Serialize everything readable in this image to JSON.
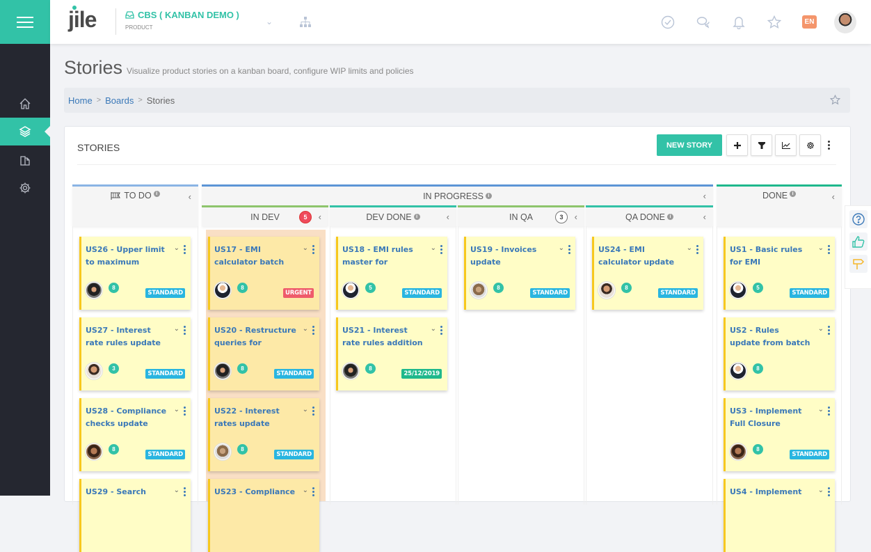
{
  "topbar": {
    "logo": "jile",
    "project_name": "CBS ( KANBAN DEMO )",
    "project_type": "PRODUCT",
    "language": "EN",
    "accent_color": "#32c2a7"
  },
  "sidebar": {
    "items": [
      {
        "name": "home",
        "icon": "home-icon",
        "active": false
      },
      {
        "name": "boards",
        "icon": "layers-icon",
        "active": true
      },
      {
        "name": "documents",
        "icon": "documents-icon",
        "active": false
      },
      {
        "name": "settings",
        "icon": "gear-icon",
        "active": false
      }
    ]
  },
  "page": {
    "title": "Stories",
    "subtitle": "Visualize product stories on a kanban board, configure WIP limits and policies"
  },
  "breadcrumb": {
    "items": [
      "Home",
      "Boards",
      "Stories"
    ]
  },
  "panel": {
    "title": "STORIES",
    "new_story_label": "NEW STORY"
  },
  "board": {
    "groups": {
      "todo": "TO DO",
      "in_progress": "IN PROGRESS",
      "done": "DONE"
    },
    "subcolumns": {
      "in_dev": {
        "label": "IN DEV",
        "wip": "5"
      },
      "dev_done": {
        "label": "DEV DONE"
      },
      "in_qa": {
        "label": "IN QA",
        "wip": "3"
      },
      "qa_done": {
        "label": "QA DONE"
      }
    },
    "columns": {
      "todo": [
        {
          "title": "US26 - Upper limit to maximum",
          "points": "8",
          "tag": "STANDARD",
          "tag_type": "standard",
          "avatar": "av1"
        },
        {
          "title": "US27 - Interest rate rules update",
          "points": "3",
          "tag": "STANDARD",
          "tag_type": "standard",
          "avatar": "av3"
        },
        {
          "title": "US28 - Compliance checks update",
          "points": "8",
          "tag": "STANDARD",
          "tag_type": "standard",
          "avatar": "av5"
        },
        {
          "title": "US29 - Search",
          "points": "",
          "tag": "",
          "tag_type": "",
          "avatar": ""
        }
      ],
      "in_dev": [
        {
          "title": "US17 - EMI calculator batch",
          "points": "8",
          "tag": "URGENT",
          "tag_type": "urgent",
          "avatar": "av2"
        },
        {
          "title": "US20 - Restructure queries for",
          "points": "8",
          "tag": "STANDARD",
          "tag_type": "standard",
          "avatar": "av1"
        },
        {
          "title": "US22 - Interest rates update",
          "points": "8",
          "tag": "STANDARD",
          "tag_type": "standard",
          "avatar": "av4"
        },
        {
          "title": "US23 - Compliance",
          "points": "",
          "tag": "",
          "tag_type": "",
          "avatar": ""
        }
      ],
      "dev_done": [
        {
          "title": "US18 - EMI rules master for",
          "points": "5",
          "tag": "STANDARD",
          "tag_type": "standard",
          "avatar": "av2"
        },
        {
          "title": "US21 - Interest rate rules addition",
          "points": "8",
          "tag": "25/12/2019",
          "tag_type": "date",
          "avatar": "av1"
        }
      ],
      "in_qa": [
        {
          "title": "US19 - Invoices update",
          "points": "8",
          "tag": "STANDARD",
          "tag_type": "standard",
          "avatar": "av4"
        }
      ],
      "qa_done": [
        {
          "title": "US24 - EMI calculator update",
          "points": "8",
          "tag": "STANDARD",
          "tag_type": "standard",
          "avatar": "av3"
        }
      ],
      "done": [
        {
          "title": "US1 - Basic rules for EMI",
          "points": "5",
          "tag": "STANDARD",
          "tag_type": "standard",
          "avatar": "av2"
        },
        {
          "title": "US2 - Rules update from batch",
          "points": "8",
          "tag": "",
          "tag_type": "",
          "avatar": "av2"
        },
        {
          "title": "US3 - Implement Full Closure",
          "points": "8",
          "tag": "STANDARD",
          "tag_type": "standard",
          "avatar": "av5"
        },
        {
          "title": "US4 - Implement",
          "points": "",
          "tag": "",
          "tag_type": "",
          "avatar": ""
        }
      ]
    }
  }
}
